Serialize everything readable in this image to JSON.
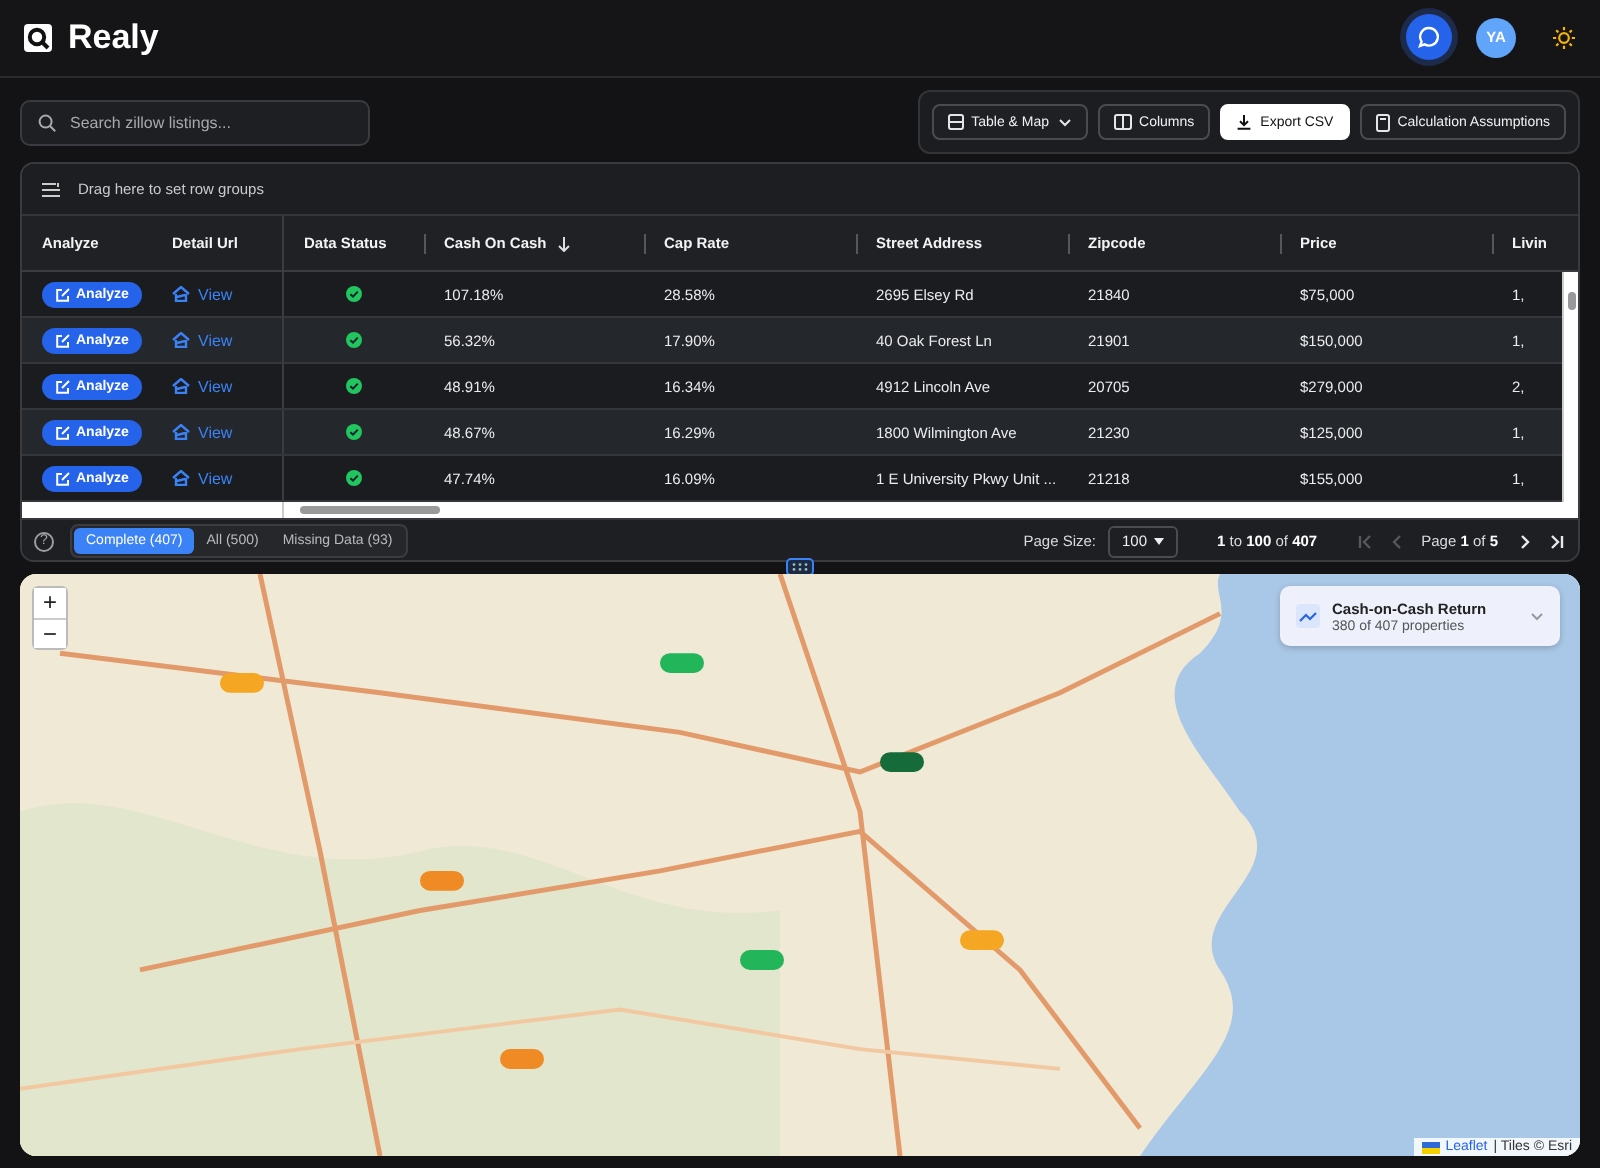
{
  "app": {
    "title": "Realy",
    "avatar": "YA"
  },
  "search": {
    "placeholder": "Search zillow listings..."
  },
  "toolbar": [
    {
      "label": "Table & Map",
      "kind": "dropdown",
      "selected": false
    },
    {
      "label": "Columns",
      "kind": "columns",
      "selected": false
    },
    {
      "label": "Export CSV",
      "kind": "export",
      "selected": true
    },
    {
      "label": "Calculation Assumptions",
      "kind": "calc",
      "selected": false
    }
  ],
  "grid": {
    "group_hint": "Drag here to set row groups",
    "columns": [
      {
        "label": "Analyze",
        "sorted_descending": false
      },
      {
        "label": "Detail Url",
        "sorted_descending": false
      },
      {
        "label": "Data Status",
        "sorted_descending": false
      },
      {
        "label": "Cash On Cash",
        "sorted_descending": true
      },
      {
        "label": "Cap Rate",
        "sorted_descending": false
      },
      {
        "label": "Street Address",
        "sorted_descending": false
      },
      {
        "label": "Zipcode",
        "sorted_descending": false
      },
      {
        "label": "Price",
        "sorted_descending": false
      },
      {
        "label": "Livin",
        "sorted_descending": false
      }
    ],
    "rows": [
      {
        "complete": true,
        "cells": [
          "Analyze",
          "View",
          "",
          "107.18%",
          "28.58%",
          "2695 Elsey Rd",
          "21840",
          "$75,000",
          "1,"
        ]
      },
      {
        "complete": true,
        "cells": [
          "Analyze",
          "View",
          "",
          "56.32%",
          "17.90%",
          "40 Oak Forest Ln",
          "21901",
          "$150,000",
          "1,"
        ]
      },
      {
        "complete": true,
        "cells": [
          "Analyze",
          "View",
          "",
          "48.91%",
          "16.34%",
          "4912 Lincoln Ave",
          "20705",
          "$279,000",
          "2,"
        ]
      },
      {
        "complete": true,
        "cells": [
          "Analyze",
          "View",
          "",
          "48.67%",
          "16.29%",
          "1800 Wilmington Ave",
          "21230",
          "$125,000",
          "1,"
        ]
      },
      {
        "complete": true,
        "cells": [
          "Analyze",
          "View",
          "",
          "47.74%",
          "16.09%",
          "1 E University Pkwy Unit ...",
          "21218",
          "$155,000",
          "1,"
        ]
      }
    ]
  },
  "footer": {
    "help": "?",
    "filters": [
      {
        "label": "Complete (407)",
        "selected": true
      },
      {
        "label": "All (500)",
        "selected": false
      },
      {
        "label": "Missing Data (93)",
        "selected": false
      }
    ],
    "page_size_label": "Page Size:",
    "page_size": "100",
    "range": "**1** to **100** of **407**",
    "page": "Page **1** of **5**",
    "nav": [
      {
        "kind": "first",
        "disabled": true
      },
      {
        "kind": "prev",
        "disabled": true
      },
      {
        "kind": "next",
        "disabled": false
      },
      {
        "kind": "last",
        "disabled": false
      }
    ]
  },
  "map": {
    "zoom_in": "+",
    "zoom_out": "−",
    "legend": {
      "title": "Cash-on-Cash Return",
      "subtitle": "380 of 407 properties"
    },
    "attribution": {
      "link": "Leaflet",
      "text": "| Tiles © Esri"
    }
  }
}
